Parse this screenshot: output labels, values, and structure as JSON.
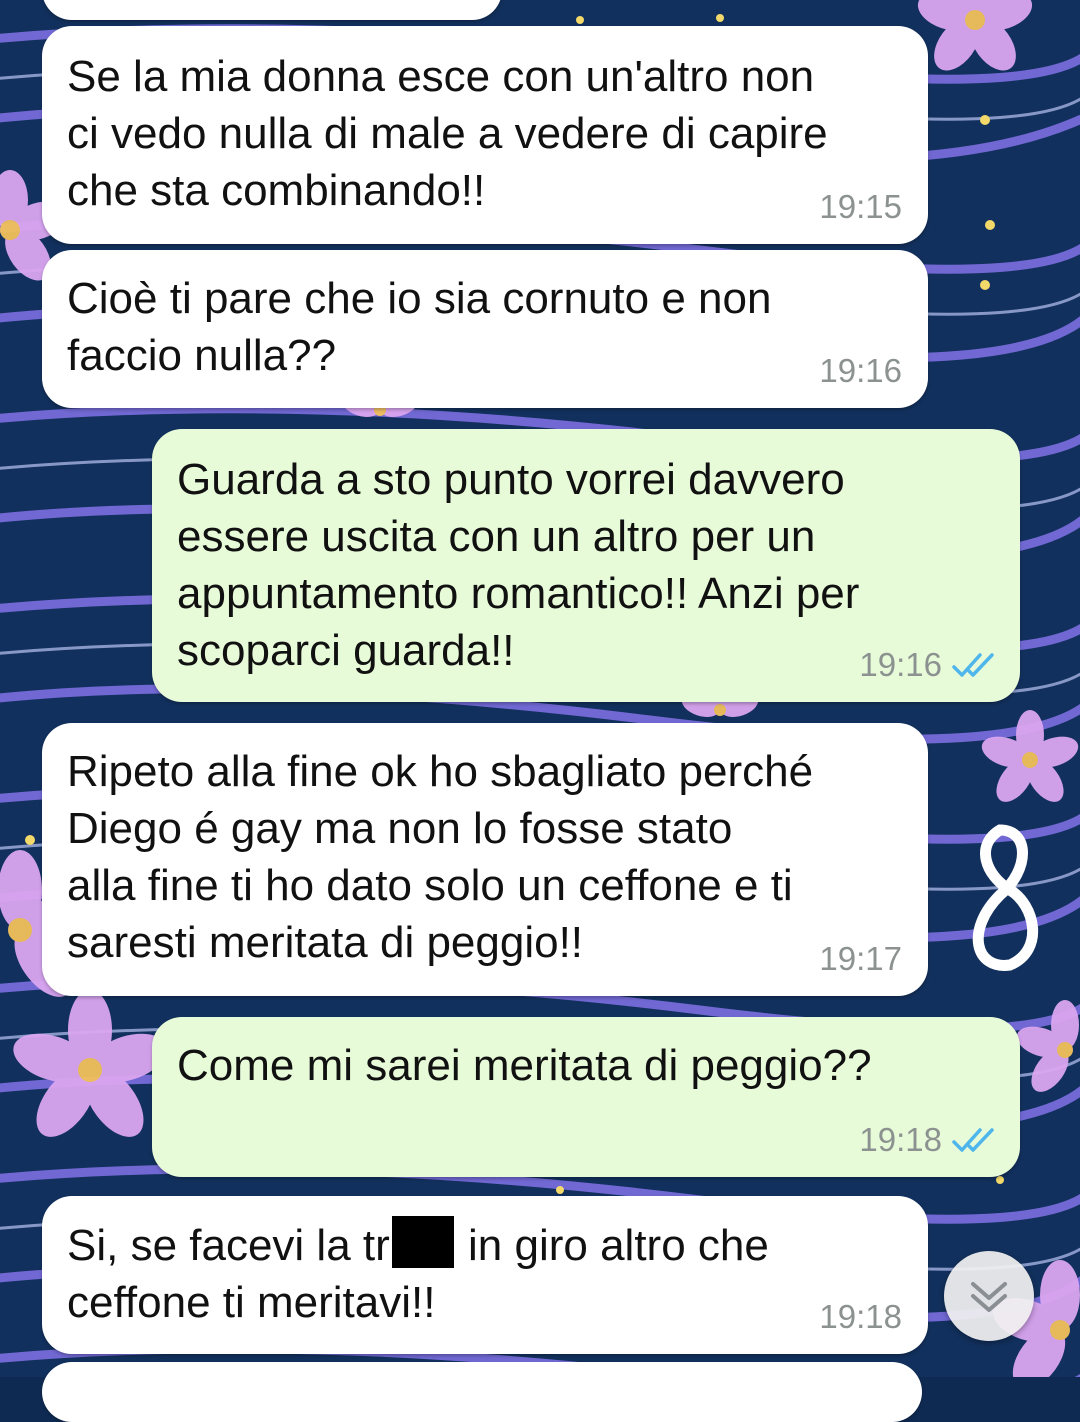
{
  "chat": {
    "messages": [
      {
        "type": "incoming",
        "text": "Se la mia donna esce con un'altro non\nci vedo nulla di male a vedere di capire\nche sta combinando!!",
        "time": "19:15"
      },
      {
        "type": "incoming",
        "text": "Cioè ti pare che io sia cornuto e non\nfaccio nulla??",
        "time": "19:16"
      },
      {
        "type": "outgoing",
        "text": "Guarda a sto punto vorrei davvero\nessere uscita con un altro per un\nappuntamento romantico!! Anzi per\nscoparci guarda!!",
        "time": "19:16",
        "status": "read"
      },
      {
        "type": "incoming",
        "text": "Ripeto alla fine ok ho sbagliato perché\nDiego é gay ma non lo fosse stato\nalla fine ti ho dato solo un ceffone e ti\nsaresti meritata di peggio!!",
        "time": "19:17"
      },
      {
        "type": "outgoing",
        "text": "Come mi sarei meritata di peggio??",
        "time": "19:18",
        "status": "read"
      },
      {
        "type": "incoming",
        "text_before": "Si, se facevi la tr",
        "text_after": " in giro altro che\nceffone ti meritavi!!",
        "time": "19:18"
      }
    ]
  },
  "icons": {
    "read_receipt": "double-check-icon",
    "scroll_down": "double-chevron-down-icon"
  },
  "colors": {
    "incoming_bubble": "#ffffff",
    "outgoing_bubble": "#e8fbd9",
    "read_tick": "#4fb6ec",
    "wallpaper": "#0f2a52"
  }
}
